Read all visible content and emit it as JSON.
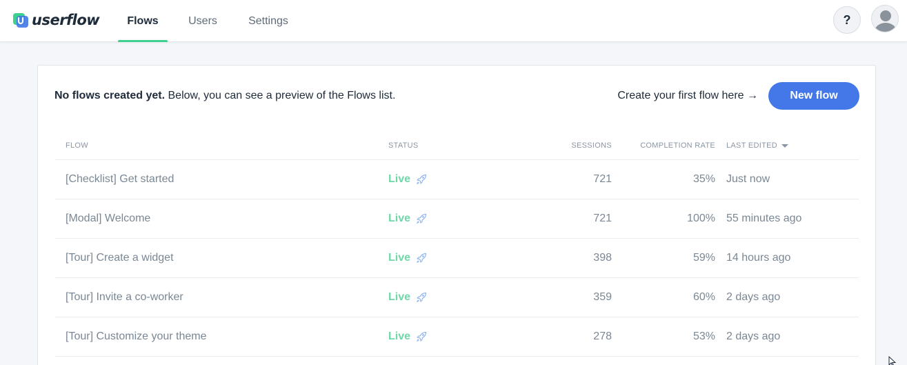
{
  "app": {
    "logo_text": "userflow",
    "brand_color": "#3ed08f",
    "accent_color": "#4478e8"
  },
  "nav": {
    "tabs": [
      {
        "label": "Flows",
        "active": true
      },
      {
        "label": "Users",
        "active": false
      },
      {
        "label": "Settings",
        "active": false
      }
    ],
    "help_label": "?"
  },
  "notice": {
    "bold": "No flows created yet.",
    "rest": " Below, you can see a preview of the Flows list."
  },
  "cta": {
    "hint": "Create your first flow here",
    "arrow": "→",
    "button_label": "New flow"
  },
  "table": {
    "headers": {
      "flow": "FLOW",
      "status": "STATUS",
      "sessions": "SESSIONS",
      "completion_rate": "COMPLETION RATE",
      "last_edited": "LAST EDITED"
    },
    "rows": [
      {
        "flow": "[Checklist] Get started",
        "status": "Live",
        "sessions": "721",
        "completion_rate": "35%",
        "last_edited": "Just now"
      },
      {
        "flow": "[Modal] Welcome",
        "status": "Live",
        "sessions": "721",
        "completion_rate": "100%",
        "last_edited": "55 minutes ago"
      },
      {
        "flow": "[Tour] Create a widget",
        "status": "Live",
        "sessions": "398",
        "completion_rate": "59%",
        "last_edited": "14 hours ago"
      },
      {
        "flow": "[Tour] Invite a co-worker",
        "status": "Live",
        "sessions": "359",
        "completion_rate": "60%",
        "last_edited": "2 days ago"
      },
      {
        "flow": "[Tour] Customize your theme",
        "status": "Live",
        "sessions": "278",
        "completion_rate": "53%",
        "last_edited": "2 days ago"
      }
    ]
  }
}
